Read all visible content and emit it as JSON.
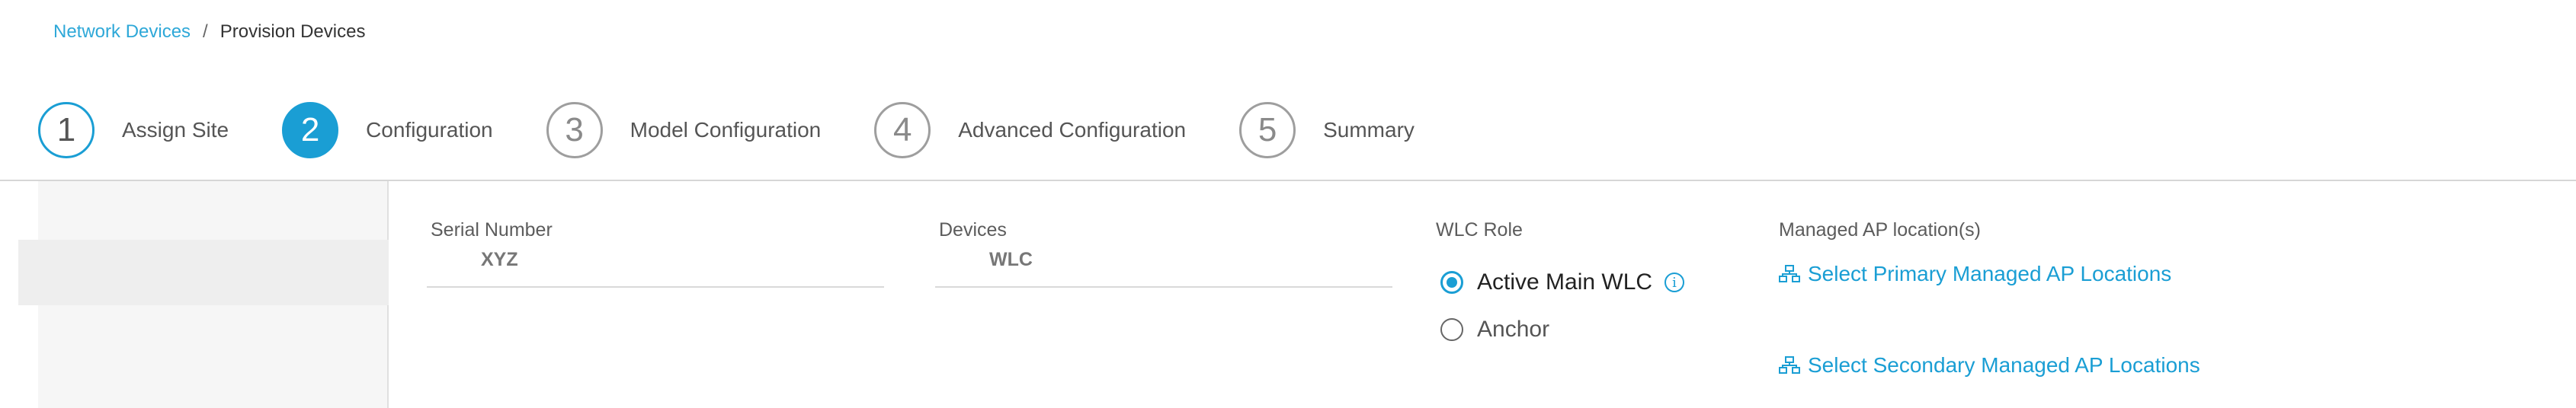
{
  "breadcrumb": {
    "parent": "Network Devices",
    "separator": "/",
    "current": "Provision Devices"
  },
  "steps": [
    {
      "number": "1",
      "label": "Assign Site",
      "state": "done"
    },
    {
      "number": "2",
      "label": "Configuration",
      "state": "active"
    },
    {
      "number": "3",
      "label": "Model Configuration",
      "state": "pending"
    },
    {
      "number": "4",
      "label": "Advanced Configuration",
      "state": "pending"
    },
    {
      "number": "5",
      "label": "Summary",
      "state": "pending"
    }
  ],
  "form": {
    "serial_number": {
      "label": "Serial Number",
      "value": "XYZ"
    },
    "devices": {
      "label": "Devices",
      "value": "WLC"
    },
    "wlc_role": {
      "label": "WLC Role",
      "options": [
        {
          "label": "Active Main WLC",
          "selected": true
        },
        {
          "label": "Anchor",
          "selected": false
        }
      ]
    },
    "managed_ap": {
      "label": "Managed AP location(s)",
      "primary_link": "Select Primary Managed AP Locations",
      "secondary_link": "Select Secondary Managed AP Locations"
    }
  },
  "colors": {
    "accent": "#1a9ed4",
    "link": "#2ea8d8"
  },
  "icons": {
    "info": "info-icon",
    "location": "location-hierarchy-icon"
  }
}
